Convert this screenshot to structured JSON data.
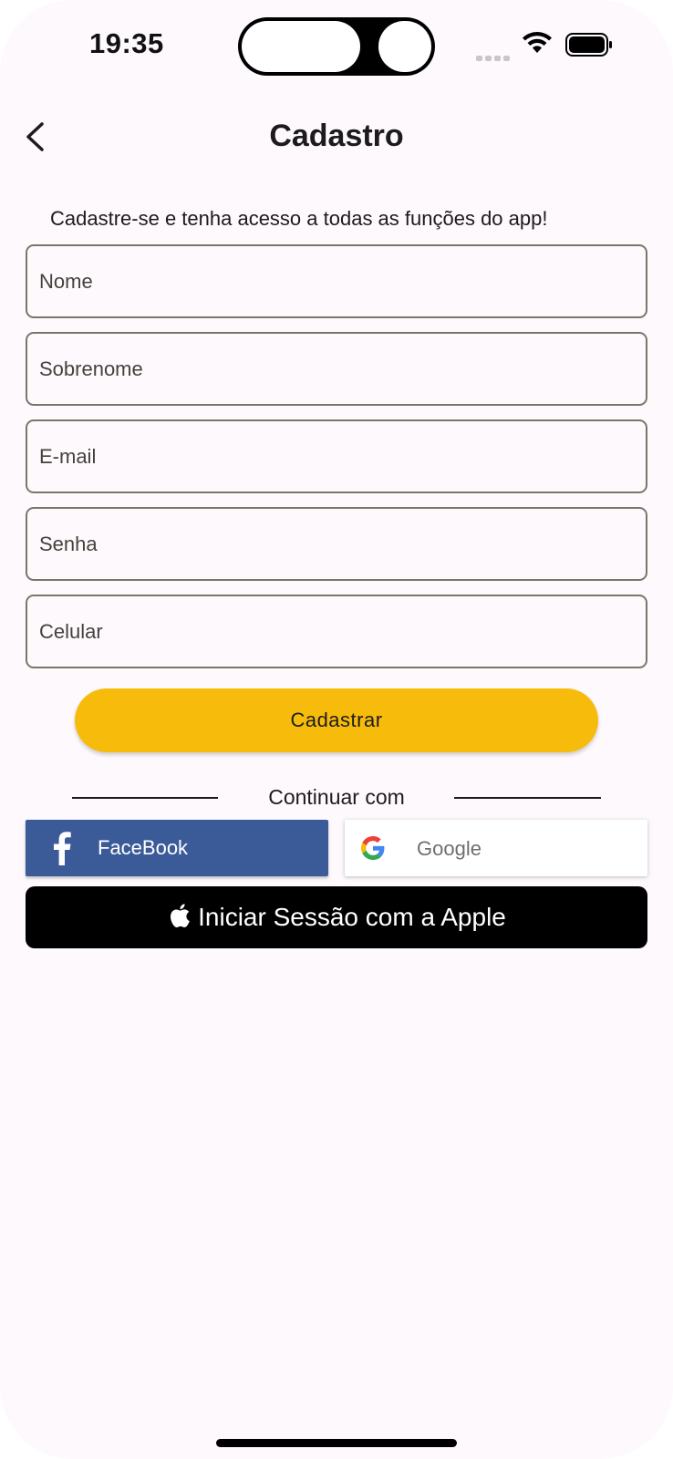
{
  "status_bar": {
    "time": "19:35"
  },
  "header": {
    "title": "Cadastro",
    "back_icon": "chevron-left-icon"
  },
  "form": {
    "subtitle": "Cadastre-se e tenha acesso a todas as funções do app!",
    "fields": {
      "nome": {
        "value": "",
        "placeholder": "Nome"
      },
      "sobrenome": {
        "value": "",
        "placeholder": "Sobrenome"
      },
      "email": {
        "value": "",
        "placeholder": "E-mail"
      },
      "senha": {
        "value": "",
        "placeholder": "Senha"
      },
      "celular": {
        "value": "",
        "placeholder": "Celular"
      }
    },
    "submit_label": "Cadastrar"
  },
  "social": {
    "divider_label": "Continuar com",
    "facebook_label": "FaceBook",
    "google_label": "Google",
    "apple_label": "Iniciar Sessão com a Apple"
  },
  "colors": {
    "background": "#fdf9fd",
    "primary_button": "#f7bc0b",
    "facebook": "#3b5b98",
    "apple": "#000000",
    "field_border": "#7a7768"
  }
}
